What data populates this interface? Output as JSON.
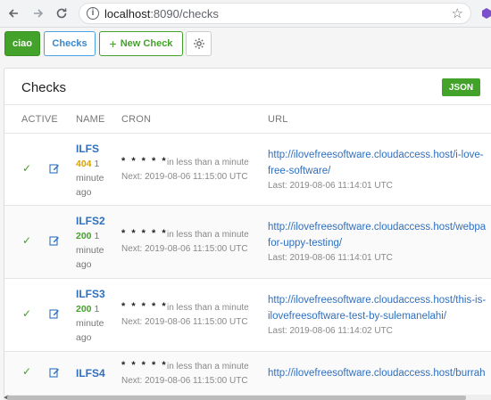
{
  "browser": {
    "url_host": "localhost",
    "url_path": ":8090/checks"
  },
  "toolbar": {
    "home_label": "ciao",
    "checks_label": "Checks",
    "new_check_label": "New Check"
  },
  "panel": {
    "title": "Checks",
    "json_label": "JSON",
    "columns": [
      "ACTIVE",
      "NAME",
      "CRON",
      "URL"
    ]
  },
  "checks": [
    {
      "name": "ILFS",
      "status_code": "404",
      "status_time_1": "1",
      "status_time_2": "minute",
      "status_time_3": "ago",
      "cron": "* * * * *",
      "cron_relative": "in less than a minute",
      "cron_next": "Next: 2019-08-06 11:15:00 UTC",
      "url_line1": "http://ilovefreesoftware.cloudaccess.host/i-love-",
      "url_line2": "free-software/",
      "last": "Last: 2019-08-06 11:14:01 UTC"
    },
    {
      "name": "ILFS2",
      "status_code": "200",
      "status_time_1": "1",
      "status_time_2": "minute",
      "status_time_3": "ago",
      "cron": "* * * * *",
      "cron_relative": "in less than a minute",
      "cron_next": "Next: 2019-08-06 11:15:00 UTC",
      "url_line1": "http://ilovefreesoftware.cloudaccess.host/webpa",
      "url_line2": "for-uppy-testing/",
      "last": "Last: 2019-08-06 11:14:01 UTC"
    },
    {
      "name": "ILFS3",
      "status_code": "200",
      "status_time_1": "1",
      "status_time_2": "minute",
      "status_time_3": "ago",
      "cron": "* * * * *",
      "cron_relative": "in less than a minute",
      "cron_next": "Next: 2019-08-06 11:15:00 UTC",
      "url_line1": "http://ilovefreesoftware.cloudaccess.host/this-is-",
      "url_line2": "ilovefreesoftware-test-by-sulemanelahi/",
      "last": "Last: 2019-08-06 11:14:02 UTC"
    },
    {
      "name": "ILFS4",
      "cron": "* * * * *",
      "cron_relative": "in less than a minute",
      "cron_next": "Next: 2019-08-06 11:15:00 UTC",
      "url_line1": "http://ilovefreesoftware.cloudaccess.host/burrah"
    }
  ],
  "icons": {
    "back": "arrow-left-icon",
    "forward": "arrow-right-icon",
    "reload": "reload-icon",
    "info": "info-icon",
    "star": "star-icon",
    "extension": "extension-icon",
    "settings": "gear-icon",
    "active": "checkmark-icon",
    "edit": "edit-icon"
  },
  "colors": {
    "primary_green": "#43a22a",
    "link_blue": "#2f6fbf",
    "status_warning": "#d8a400"
  }
}
